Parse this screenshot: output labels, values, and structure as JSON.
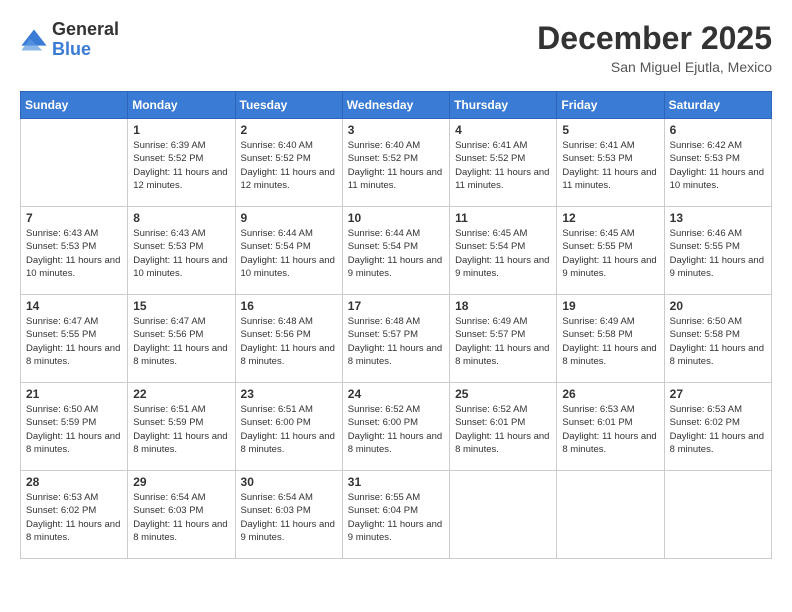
{
  "logo": {
    "text_general": "General",
    "text_blue": "Blue"
  },
  "title": "December 2025",
  "subtitle": "San Miguel Ejutla, Mexico",
  "days_of_week": [
    "Sunday",
    "Monday",
    "Tuesday",
    "Wednesday",
    "Thursday",
    "Friday",
    "Saturday"
  ],
  "weeks": [
    [
      {
        "day": "",
        "sunrise": "",
        "sunset": "",
        "daylight": ""
      },
      {
        "day": "1",
        "sunrise": "Sunrise: 6:39 AM",
        "sunset": "Sunset: 5:52 PM",
        "daylight": "Daylight: 11 hours and 12 minutes."
      },
      {
        "day": "2",
        "sunrise": "Sunrise: 6:40 AM",
        "sunset": "Sunset: 5:52 PM",
        "daylight": "Daylight: 11 hours and 12 minutes."
      },
      {
        "day": "3",
        "sunrise": "Sunrise: 6:40 AM",
        "sunset": "Sunset: 5:52 PM",
        "daylight": "Daylight: 11 hours and 11 minutes."
      },
      {
        "day": "4",
        "sunrise": "Sunrise: 6:41 AM",
        "sunset": "Sunset: 5:52 PM",
        "daylight": "Daylight: 11 hours and 11 minutes."
      },
      {
        "day": "5",
        "sunrise": "Sunrise: 6:41 AM",
        "sunset": "Sunset: 5:53 PM",
        "daylight": "Daylight: 11 hours and 11 minutes."
      },
      {
        "day": "6",
        "sunrise": "Sunrise: 6:42 AM",
        "sunset": "Sunset: 5:53 PM",
        "daylight": "Daylight: 11 hours and 10 minutes."
      }
    ],
    [
      {
        "day": "7",
        "sunrise": "Sunrise: 6:43 AM",
        "sunset": "Sunset: 5:53 PM",
        "daylight": "Daylight: 11 hours and 10 minutes."
      },
      {
        "day": "8",
        "sunrise": "Sunrise: 6:43 AM",
        "sunset": "Sunset: 5:53 PM",
        "daylight": "Daylight: 11 hours and 10 minutes."
      },
      {
        "day": "9",
        "sunrise": "Sunrise: 6:44 AM",
        "sunset": "Sunset: 5:54 PM",
        "daylight": "Daylight: 11 hours and 10 minutes."
      },
      {
        "day": "10",
        "sunrise": "Sunrise: 6:44 AM",
        "sunset": "Sunset: 5:54 PM",
        "daylight": "Daylight: 11 hours and 9 minutes."
      },
      {
        "day": "11",
        "sunrise": "Sunrise: 6:45 AM",
        "sunset": "Sunset: 5:54 PM",
        "daylight": "Daylight: 11 hours and 9 minutes."
      },
      {
        "day": "12",
        "sunrise": "Sunrise: 6:45 AM",
        "sunset": "Sunset: 5:55 PM",
        "daylight": "Daylight: 11 hours and 9 minutes."
      },
      {
        "day": "13",
        "sunrise": "Sunrise: 6:46 AM",
        "sunset": "Sunset: 5:55 PM",
        "daylight": "Daylight: 11 hours and 9 minutes."
      }
    ],
    [
      {
        "day": "14",
        "sunrise": "Sunrise: 6:47 AM",
        "sunset": "Sunset: 5:55 PM",
        "daylight": "Daylight: 11 hours and 8 minutes."
      },
      {
        "day": "15",
        "sunrise": "Sunrise: 6:47 AM",
        "sunset": "Sunset: 5:56 PM",
        "daylight": "Daylight: 11 hours and 8 minutes."
      },
      {
        "day": "16",
        "sunrise": "Sunrise: 6:48 AM",
        "sunset": "Sunset: 5:56 PM",
        "daylight": "Daylight: 11 hours and 8 minutes."
      },
      {
        "day": "17",
        "sunrise": "Sunrise: 6:48 AM",
        "sunset": "Sunset: 5:57 PM",
        "daylight": "Daylight: 11 hours and 8 minutes."
      },
      {
        "day": "18",
        "sunrise": "Sunrise: 6:49 AM",
        "sunset": "Sunset: 5:57 PM",
        "daylight": "Daylight: 11 hours and 8 minutes."
      },
      {
        "day": "19",
        "sunrise": "Sunrise: 6:49 AM",
        "sunset": "Sunset: 5:58 PM",
        "daylight": "Daylight: 11 hours and 8 minutes."
      },
      {
        "day": "20",
        "sunrise": "Sunrise: 6:50 AM",
        "sunset": "Sunset: 5:58 PM",
        "daylight": "Daylight: 11 hours and 8 minutes."
      }
    ],
    [
      {
        "day": "21",
        "sunrise": "Sunrise: 6:50 AM",
        "sunset": "Sunset: 5:59 PM",
        "daylight": "Daylight: 11 hours and 8 minutes."
      },
      {
        "day": "22",
        "sunrise": "Sunrise: 6:51 AM",
        "sunset": "Sunset: 5:59 PM",
        "daylight": "Daylight: 11 hours and 8 minutes."
      },
      {
        "day": "23",
        "sunrise": "Sunrise: 6:51 AM",
        "sunset": "Sunset: 6:00 PM",
        "daylight": "Daylight: 11 hours and 8 minutes."
      },
      {
        "day": "24",
        "sunrise": "Sunrise: 6:52 AM",
        "sunset": "Sunset: 6:00 PM",
        "daylight": "Daylight: 11 hours and 8 minutes."
      },
      {
        "day": "25",
        "sunrise": "Sunrise: 6:52 AM",
        "sunset": "Sunset: 6:01 PM",
        "daylight": "Daylight: 11 hours and 8 minutes."
      },
      {
        "day": "26",
        "sunrise": "Sunrise: 6:53 AM",
        "sunset": "Sunset: 6:01 PM",
        "daylight": "Daylight: 11 hours and 8 minutes."
      },
      {
        "day": "27",
        "sunrise": "Sunrise: 6:53 AM",
        "sunset": "Sunset: 6:02 PM",
        "daylight": "Daylight: 11 hours and 8 minutes."
      }
    ],
    [
      {
        "day": "28",
        "sunrise": "Sunrise: 6:53 AM",
        "sunset": "Sunset: 6:02 PM",
        "daylight": "Daylight: 11 hours and 8 minutes."
      },
      {
        "day": "29",
        "sunrise": "Sunrise: 6:54 AM",
        "sunset": "Sunset: 6:03 PM",
        "daylight": "Daylight: 11 hours and 8 minutes."
      },
      {
        "day": "30",
        "sunrise": "Sunrise: 6:54 AM",
        "sunset": "Sunset: 6:03 PM",
        "daylight": "Daylight: 11 hours and 9 minutes."
      },
      {
        "day": "31",
        "sunrise": "Sunrise: 6:55 AM",
        "sunset": "Sunset: 6:04 PM",
        "daylight": "Daylight: 11 hours and 9 minutes."
      },
      {
        "day": "",
        "sunrise": "",
        "sunset": "",
        "daylight": ""
      },
      {
        "day": "",
        "sunrise": "",
        "sunset": "",
        "daylight": ""
      },
      {
        "day": "",
        "sunrise": "",
        "sunset": "",
        "daylight": ""
      }
    ]
  ]
}
